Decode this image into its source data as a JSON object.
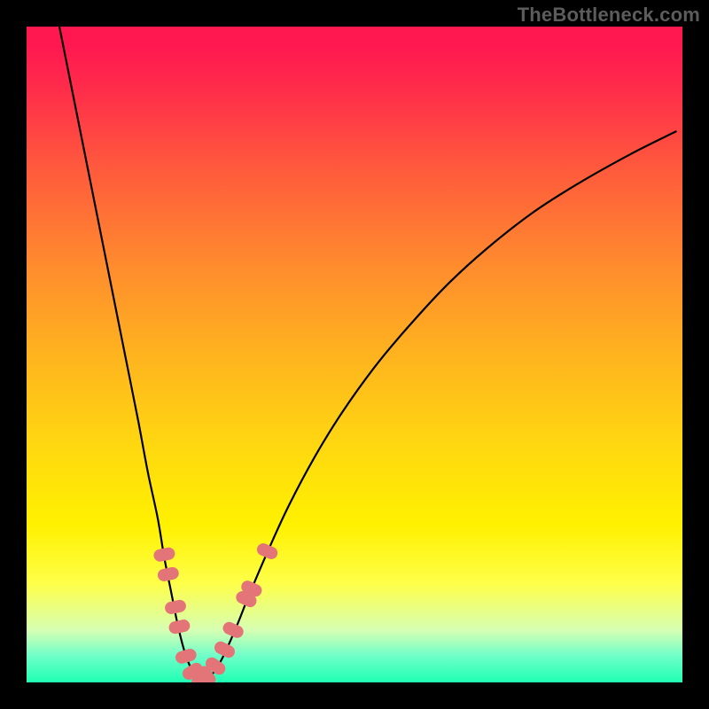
{
  "watermark": "TheBottleneck.com",
  "accent_dot_color": "#e37579",
  "curve_color": "#000000",
  "chart_data": {
    "type": "line",
    "title": "",
    "xlabel": "",
    "ylabel": "",
    "xlim": [
      0,
      100
    ],
    "ylim": [
      0,
      100
    ],
    "series": [
      {
        "name": "curve",
        "x": [
          5,
          7,
          9,
          11,
          13,
          15,
          17,
          18.5,
          20,
          21,
          22,
          23,
          24,
          25,
          26,
          27,
          28.5,
          30,
          32,
          34,
          37,
          40,
          44,
          48,
          53,
          58,
          64,
          70,
          77,
          84,
          92,
          99
        ],
        "y": [
          100,
          90,
          80,
          70,
          60,
          50,
          40,
          32,
          25,
          19,
          14,
          9,
          5,
          2.3,
          0.8,
          0.5,
          1.5,
          4,
          8.5,
          13.5,
          20.5,
          27,
          34.5,
          41,
          48,
          54,
          60.5,
          66,
          71.5,
          76,
          80.5,
          84
        ]
      }
    ],
    "dots": [
      {
        "x": 21.0,
        "y": 19.5
      },
      {
        "x": 21.6,
        "y": 16.5
      },
      {
        "x": 22.7,
        "y": 11.5
      },
      {
        "x": 23.3,
        "y": 8.5
      },
      {
        "x": 24.3,
        "y": 4.0
      },
      {
        "x": 25.3,
        "y": 1.7
      },
      {
        "x": 26.3,
        "y": 0.7
      },
      {
        "x": 27.5,
        "y": 1.0
      },
      {
        "x": 28.8,
        "y": 2.5
      },
      {
        "x": 30.2,
        "y": 5.0
      },
      {
        "x": 31.5,
        "y": 8.0
      },
      {
        "x": 33.5,
        "y": 12.7
      },
      {
        "x": 34.3,
        "y": 14.3
      },
      {
        "x": 36.7,
        "y": 20.0
      }
    ]
  }
}
